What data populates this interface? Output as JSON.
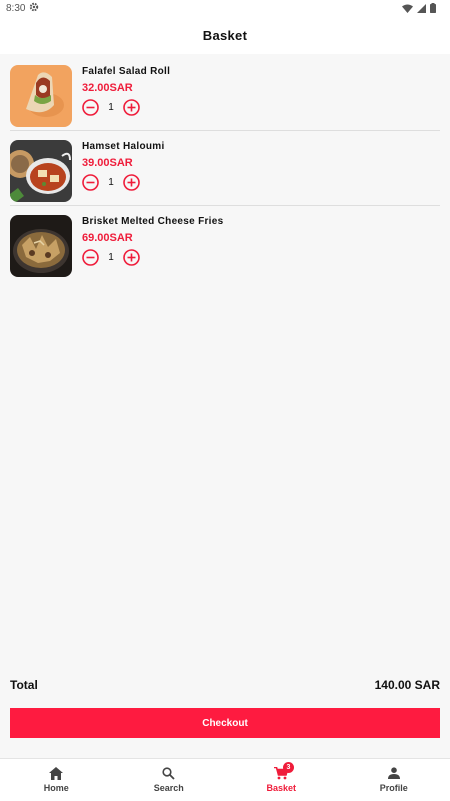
{
  "status": {
    "time": "8:30"
  },
  "header": {
    "title": "Basket"
  },
  "items": [
    {
      "name": "Falafel Salad Roll",
      "price": "32.00SAR",
      "qty": "1"
    },
    {
      "name": "Hamset Haloumi",
      "price": "39.00SAR",
      "qty": "1"
    },
    {
      "name": "Brisket Melted Cheese Fries",
      "price": "69.00SAR",
      "qty": "1"
    }
  ],
  "summary": {
    "total_label": "Total",
    "total_value": "140.00 SAR"
  },
  "checkout_label": "Checkout",
  "nav": {
    "items": [
      {
        "label": "Home",
        "icon": "home-icon"
      },
      {
        "label": "Search",
        "icon": "search-icon"
      },
      {
        "label": "Basket",
        "icon": "cart-icon",
        "badge": "3"
      },
      {
        "label": "Profile",
        "icon": "person-icon"
      }
    ]
  },
  "colors": {
    "accent": "#ef1c3a",
    "checkout": "#fe1b40"
  }
}
